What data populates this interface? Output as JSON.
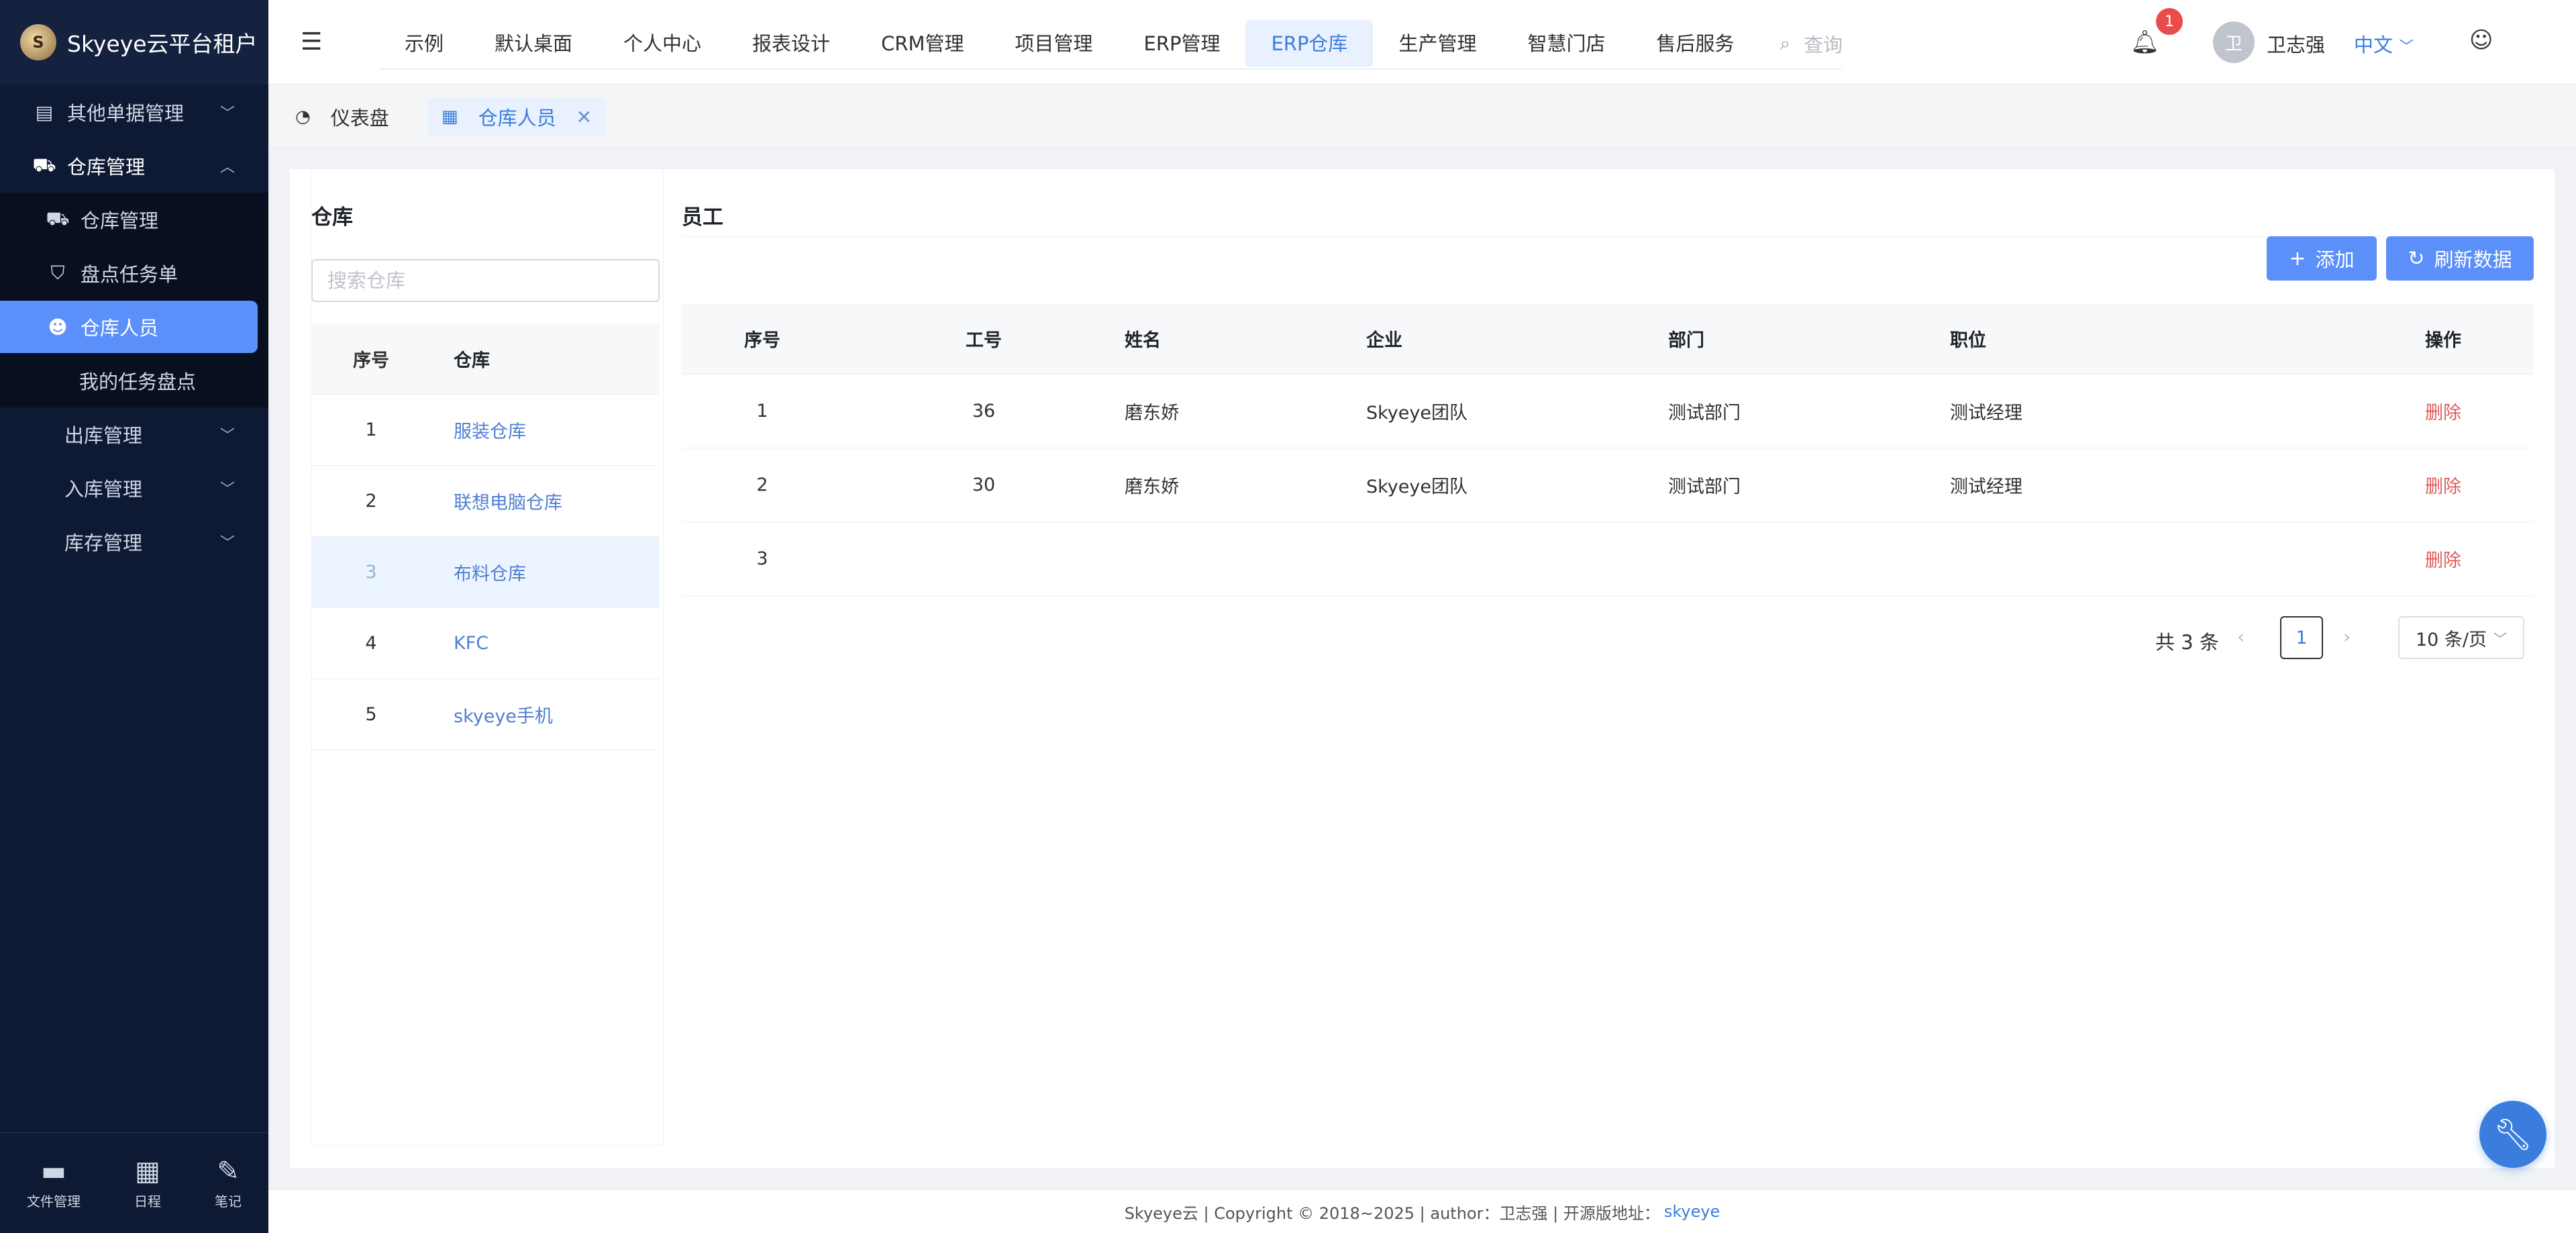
{
  "brand": {
    "name": "Skyeye云平台租户"
  },
  "sidebar": {
    "items": [
      {
        "label": "其他单据管理",
        "icon": "archive-icon",
        "glyph": "▤",
        "expanded": false
      },
      {
        "label": "仓库管理",
        "icon": "cart-icon",
        "glyph": "🛒",
        "expanded": true
      },
      {
        "label": "仓库管理",
        "icon": "truck-icon",
        "glyph": "🚚"
      },
      {
        "label": "盘点任务单",
        "icon": "cart-icon",
        "glyph": "🛒"
      },
      {
        "label": "仓库人员",
        "icon": "user-icon",
        "glyph": "👤",
        "active": true
      },
      {
        "label": "我的任务盘点"
      },
      {
        "label": "出库管理",
        "expanded": false
      },
      {
        "label": "入库管理",
        "expanded": false
      },
      {
        "label": "库存管理",
        "expanded": false
      }
    ],
    "footer": [
      {
        "label": "文件管理",
        "icon": "folder-icon"
      },
      {
        "label": "日程",
        "icon": "calendar-icon"
      },
      {
        "label": "笔记",
        "icon": "edit-icon"
      }
    ]
  },
  "header": {
    "nav": [
      "示例",
      "默认桌面",
      "个人中心",
      "报表设计",
      "CRM管理",
      "项目管理",
      "ERP管理",
      "ERP仓库",
      "生产管理",
      "智慧门店",
      "售后服务"
    ],
    "active_nav": "ERP仓库",
    "search_placeholder": "查询",
    "notification_count": "1",
    "avatar_initial": "卫",
    "username": "卫志强",
    "language": "中文"
  },
  "tabs": [
    {
      "label": "仪表盘",
      "icon": "dashboard-icon"
    },
    {
      "label": "仓库人员",
      "icon": "grid-icon",
      "active": true
    }
  ],
  "warehouse_panel": {
    "title": "仓库",
    "search_placeholder": "搜索仓库",
    "columns": [
      "序号",
      "仓库"
    ],
    "rows": [
      {
        "no": "1",
        "name": "服装仓库"
      },
      {
        "no": "2",
        "name": "联想电脑仓库"
      },
      {
        "no": "3",
        "name": "布料仓库",
        "selected": true
      },
      {
        "no": "4",
        "name": "KFC"
      },
      {
        "no": "5",
        "name": "skyeye手机"
      }
    ]
  },
  "staff_panel": {
    "title": "员工",
    "add_label": "添加",
    "refresh_label": "刷新数据",
    "columns": [
      "序号",
      "工号",
      "姓名",
      "企业",
      "部门",
      "职位",
      "操作"
    ],
    "rows": [
      {
        "no": "1",
        "job_no": "36",
        "name": "磨东娇",
        "company": "Skyeye团队",
        "dept": "测试部门",
        "position": "测试经理",
        "action": "删除"
      },
      {
        "no": "2",
        "job_no": "30",
        "name": "磨东娇",
        "company": "Skyeye团队",
        "dept": "测试部门",
        "position": "测试经理",
        "action": "删除"
      },
      {
        "no": "3",
        "job_no": "",
        "name": "",
        "company": "",
        "dept": "",
        "position": "",
        "action": "删除"
      }
    ],
    "pagination": {
      "total": "共 3 条",
      "current": "1",
      "page_size": "10 条/页"
    }
  },
  "footer": {
    "text": "Skyeye云 | Copyright © 2018~2025 | author：卫志强 | 开源版地址：",
    "link": "skyeye"
  },
  "colors": {
    "primary": "#5b8ff9",
    "sidebar_bg": "#0e1a33",
    "danger": "#e25a5a",
    "link": "#4f7fd1"
  }
}
